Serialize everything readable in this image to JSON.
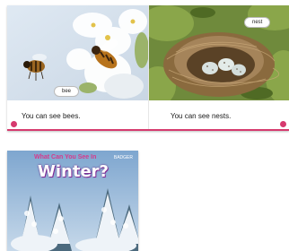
{
  "spread": {
    "left": {
      "photo_label": "bee",
      "caption": "You can see bees."
    },
    "right": {
      "photo_label": "nest",
      "caption": "You can see nests."
    }
  },
  "cover": {
    "series_title": "What Can You See In",
    "title": "Winter?",
    "brand": "BADGER"
  },
  "colors": {
    "accent": "#d63a6e",
    "cover_sky": "#8fb4d6"
  }
}
